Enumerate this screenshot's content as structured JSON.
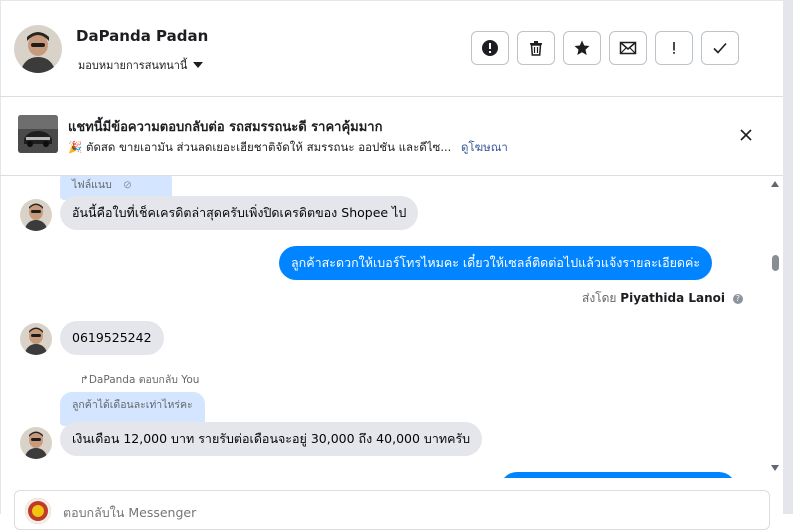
{
  "header": {
    "name": "DaPanda Padan",
    "assign_label": "มอบหมายการสนทนานี้",
    "actions": [
      "report-icon",
      "trash-icon",
      "star-icon",
      "envelope-icon",
      "exclamation-icon",
      "check-icon"
    ]
  },
  "ad": {
    "title": "แชทนี้มีข้อความตอบกลับต่อ รถสมรรถนะดี ราคาคุ้มมาก",
    "description": "🎉 ตัดสด ขายเอามัน ส่วนลดเยอะเฮียชาติจัดให้ สมรรถนะ ออปชัน และดีไซ...",
    "link": "ดูโฆษณา"
  },
  "thread": {
    "quote1": "ไฟล์แนบ",
    "msg1": "อันนี้คือใบที่เช็คเครดิตล่าสุดครับเพิ่งปิดเครดิตของ Shopee ไป",
    "msg2": "ลูกค้าสะดวกให้เบอร์โทรไหมคะ เดี๋ยวให้เซลล์ติดต่อไปแล้วแจ้งรายละเอียดค่ะ",
    "sent_by_prefix": "ส่งโดย",
    "sent_by_name": "Piyathida Lanoi",
    "msg3": "0619525242",
    "replied_label": "DaPanda ตอบกลับ You",
    "quote2": "ลูกค้าได้เดือนละเท่าไหร่คะ",
    "msg4": "เงินเดือน 12,000 บาท รายรับต่อเดือนจะอยู่ 30,000 ถึง 40,000 บาทครับ"
  },
  "composer": {
    "placeholder": "ตอบกลับใน Messenger"
  },
  "colors": {
    "outgoing": "#0084ff",
    "incoming": "#e4e6eb",
    "quote": "#d4e5ff",
    "link": "#385898"
  }
}
